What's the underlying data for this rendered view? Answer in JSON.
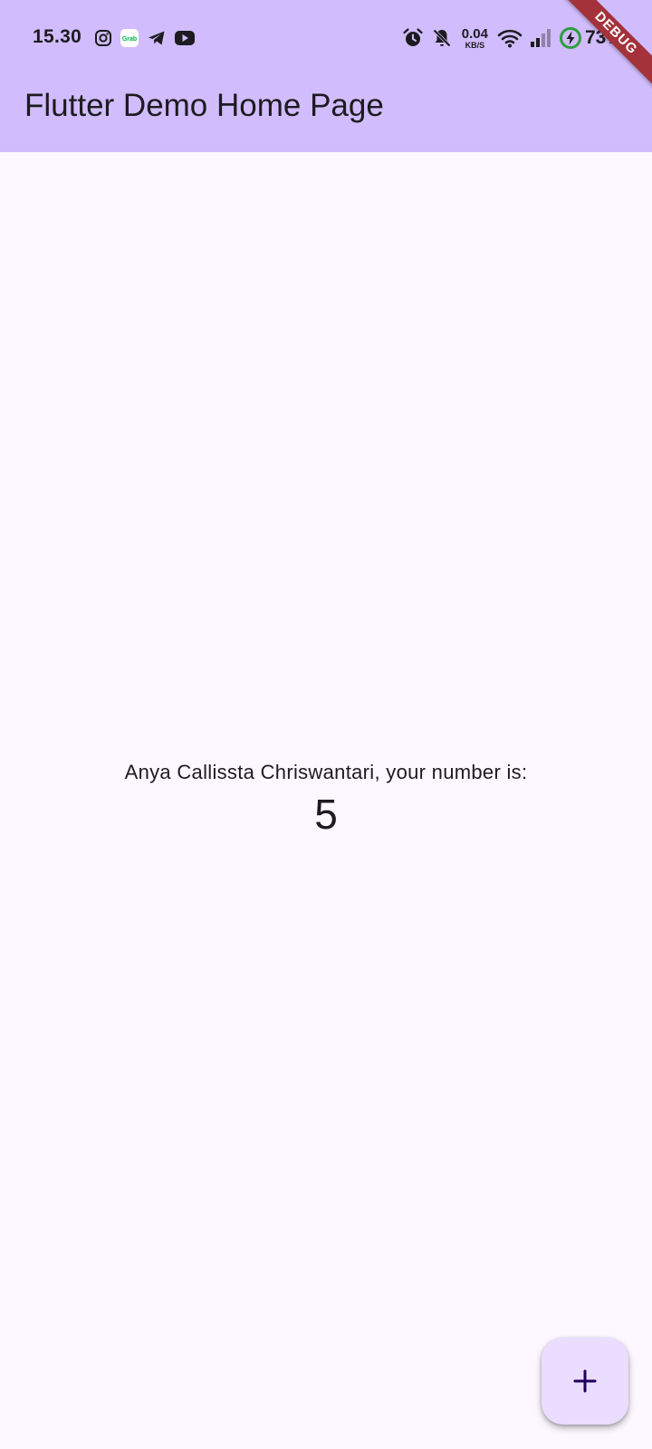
{
  "status_bar": {
    "time": "15.30",
    "left_icons": [
      "instagram-icon",
      "grab-icon",
      "telegram-icon",
      "youtube-icon"
    ],
    "right_icons": [
      "alarm-icon",
      "notifications-off-icon",
      "wifi-icon",
      "signal-icon",
      "battery-charging-icon"
    ],
    "network_speed_value": "0.04",
    "network_speed_unit": "KB/S",
    "battery_percent": "73%",
    "grab_label": "Grab"
  },
  "app_bar": {
    "title": "Flutter Demo Home Page",
    "background_color": "#D1BCFD"
  },
  "debug_banner": {
    "label": "DEBUG",
    "color": "#A3323A"
  },
  "body": {
    "message": "Anya Callissta Chriswantari, your number is:",
    "counter_value": "5",
    "background_color": "#FDF7FF"
  },
  "fab": {
    "icon": "add-icon",
    "background_color": "#EADDFF"
  }
}
